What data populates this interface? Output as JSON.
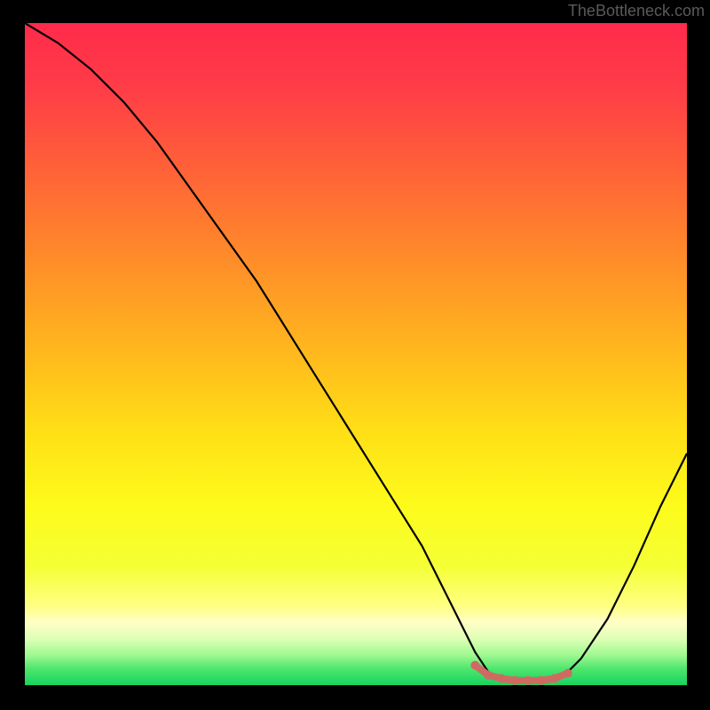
{
  "watermark": "TheBottleneck.com",
  "chart_data": {
    "type": "line",
    "title": "",
    "xlabel": "",
    "ylabel": "",
    "xlim": [
      0,
      100
    ],
    "ylim": [
      0,
      100
    ],
    "series": [
      {
        "name": "bottleneck-curve",
        "color": "#000000",
        "x": [
          0,
          5,
          10,
          15,
          20,
          25,
          30,
          35,
          40,
          45,
          50,
          55,
          60,
          65,
          68,
          70,
          72,
          74,
          76,
          78,
          80,
          82,
          84,
          88,
          92,
          96,
          100
        ],
        "y": [
          100,
          97,
          93,
          88,
          82,
          75,
          68,
          61,
          53,
          45,
          37,
          29,
          21,
          11,
          5,
          2,
          1,
          0.5,
          0.5,
          0.5,
          1,
          2,
          4,
          10,
          18,
          27,
          35
        ]
      },
      {
        "name": "optimal-band",
        "color": "#cf6a62",
        "x": [
          68,
          70,
          72,
          74,
          76,
          78,
          80,
          82
        ],
        "y": [
          3,
          1.5,
          1,
          0.7,
          0.7,
          0.7,
          1,
          1.8
        ]
      }
    ],
    "gradient_bands": [
      {
        "offset": 0.0,
        "color": "#ff2a4b"
      },
      {
        "offset": 0.1,
        "color": "#ff3d47"
      },
      {
        "offset": 0.22,
        "color": "#ff6138"
      },
      {
        "offset": 0.35,
        "color": "#ff8a2a"
      },
      {
        "offset": 0.5,
        "color": "#ffb91d"
      },
      {
        "offset": 0.62,
        "color": "#ffe016"
      },
      {
        "offset": 0.73,
        "color": "#fdfb1b"
      },
      {
        "offset": 0.82,
        "color": "#f4ff35"
      },
      {
        "offset": 0.88,
        "color": "#ffff82"
      },
      {
        "offset": 0.905,
        "color": "#ffffc6"
      },
      {
        "offset": 0.93,
        "color": "#deffb5"
      },
      {
        "offset": 0.955,
        "color": "#9ef890"
      },
      {
        "offset": 0.975,
        "color": "#4ee66e"
      },
      {
        "offset": 1.0,
        "color": "#17d45e"
      }
    ]
  }
}
